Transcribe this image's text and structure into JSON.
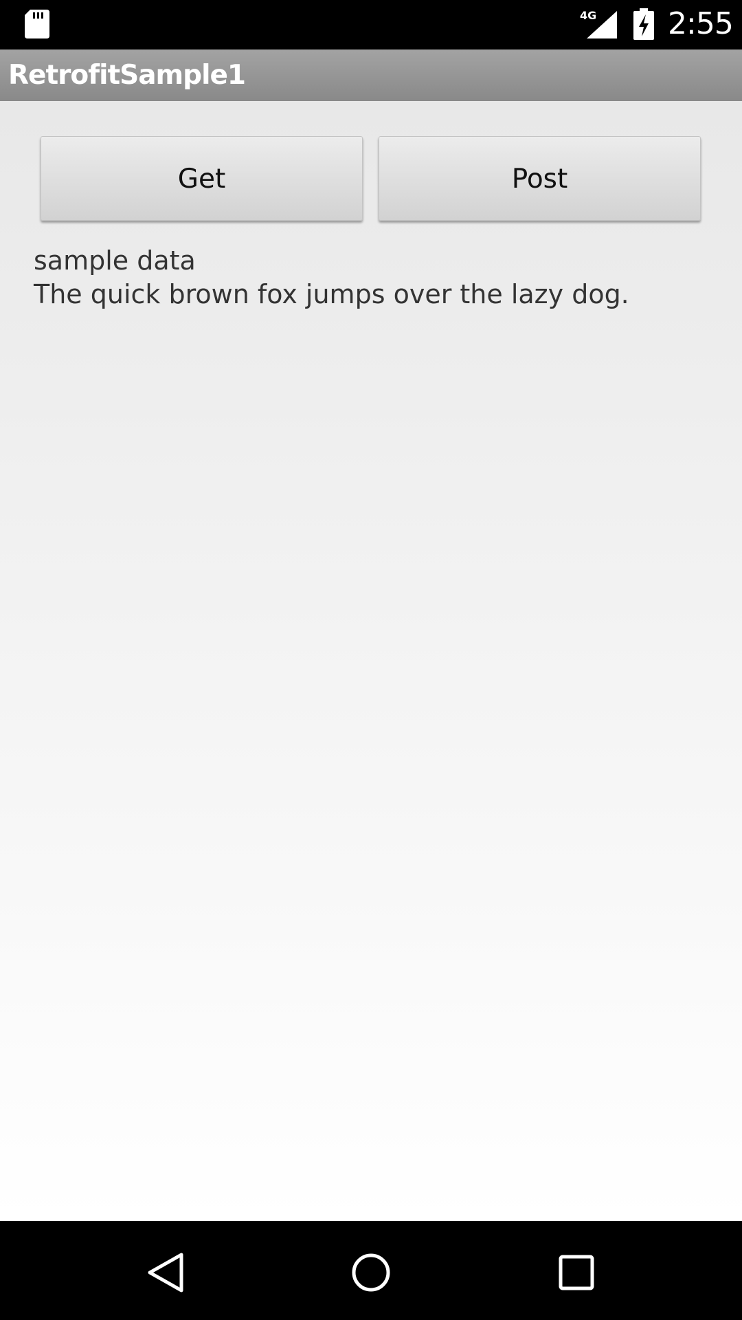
{
  "status_bar": {
    "time": "2:55",
    "network": "4G",
    "icons": [
      "sd-card-icon",
      "signal-icon",
      "battery-charging-icon"
    ]
  },
  "action_bar": {
    "title": "RetrofitSample1"
  },
  "buttons": {
    "get_label": "Get",
    "post_label": "Post"
  },
  "result": {
    "line1": "sample data",
    "line2": "The quick brown fox jumps over the lazy dog."
  },
  "nav_bar": {
    "icons": [
      "back-icon",
      "home-icon",
      "recent-apps-icon"
    ]
  },
  "colors": {
    "status_bar": "#000000",
    "action_bar": "#959595",
    "content_top": "#e8e8e8",
    "content_bottom": "#ffffff",
    "nav_bar": "#000000"
  }
}
